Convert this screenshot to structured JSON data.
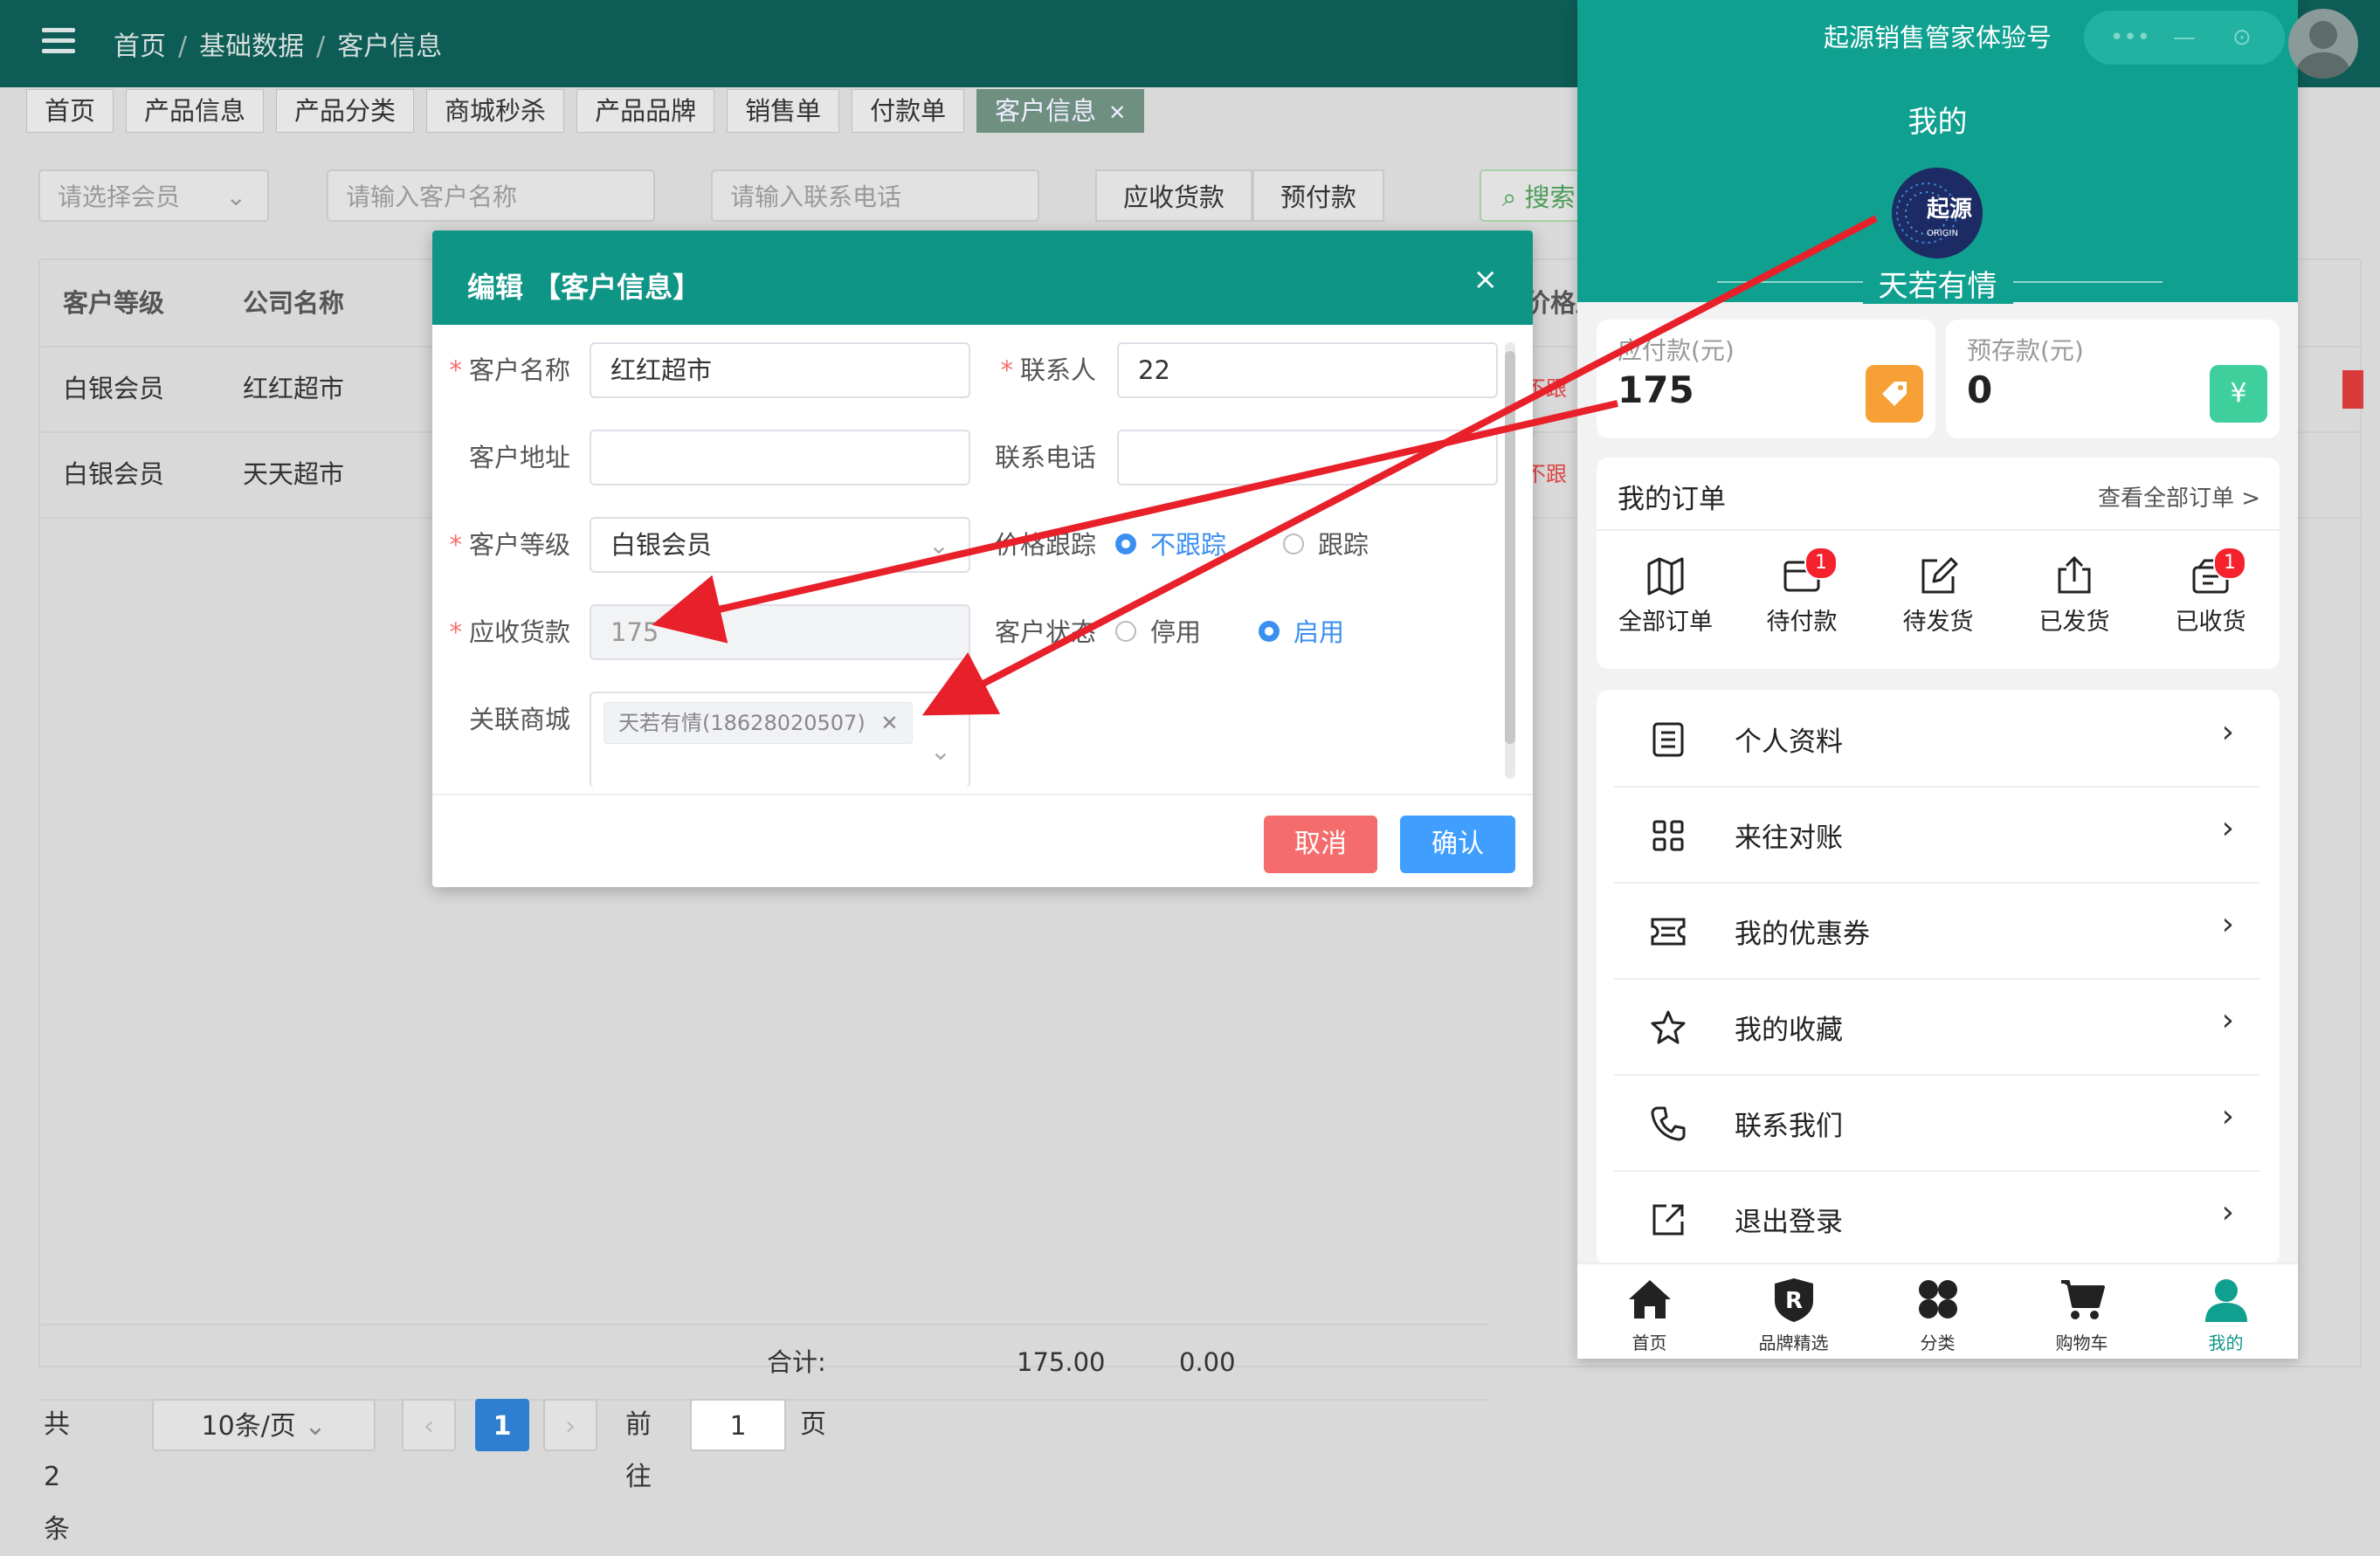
{
  "breadcrumb": [
    "首页",
    "基础数据",
    "客户信息"
  ],
  "tabs": [
    {
      "label": "首页"
    },
    {
      "label": "产品信息"
    },
    {
      "label": "产品分类"
    },
    {
      "label": "商城秒杀"
    },
    {
      "label": "产品品牌"
    },
    {
      "label": "销售单"
    },
    {
      "label": "付款单"
    },
    {
      "label": "客户信息"
    }
  ],
  "filters": {
    "member_placeholder": "请选择会员",
    "name_placeholder": "请输入客户名称",
    "phone_placeholder": "请输入联系电话",
    "btn_receivable": "应收货款",
    "btn_prepay": "预付款",
    "search": "搜索"
  },
  "table": {
    "headers": [
      "客户等级",
      "公司名称",
      "价格跟"
    ],
    "rows": [
      {
        "level": "白银会员",
        "company": "红红超市",
        "tag": "不跟"
      },
      {
        "level": "白银会员",
        "company": "天天超市",
        "tag": "不跟"
      }
    ],
    "total_label": "合计:",
    "total_receivable": "175.00",
    "total_prepay": "0.00"
  },
  "pager": {
    "total": "共 2 条",
    "page_size": "10条/页",
    "current": "1",
    "goto_label": "前往",
    "goto_value": "1",
    "page_suffix": "页",
    "prev": "‹",
    "next": "›"
  },
  "dialog": {
    "title": "编辑 【客户信息】",
    "close": "×",
    "name_label": "客户名称",
    "name_value": "红红超市",
    "contact_label": "联系人",
    "contact_value": "22",
    "address_label": "客户地址",
    "address_value": "",
    "phone_label": "联系电话",
    "phone_value": "",
    "level_label": "客户等级",
    "level_value": "白银会员",
    "price_track_label": "价格跟踪",
    "price_track_options": [
      "不跟踪",
      "跟踪"
    ],
    "price_track_selected": 0,
    "receivable_label": "应收货款",
    "receivable_value": "175",
    "status_label": "客户状态",
    "status_options": [
      "停用",
      "启用"
    ],
    "status_selected": 1,
    "mall_label": "关联商城",
    "mall_tag": "天若有情(18628020507)",
    "cancel": "取消",
    "confirm": "确认",
    "cancel_color": "#f56c6c",
    "confirm_color": "#409eff"
  },
  "phone": {
    "app_title": "起源销售管家体验号",
    "capsule_more": "•••",
    "capsule_min": "—",
    "capsule_close": "⊙",
    "page_title": "我的",
    "avatar_text": "起源",
    "avatar_sub": "ORIGIN",
    "username": "天若有情",
    "payable_label": "应付款(元)",
    "payable_value": "175",
    "deposit_label": "预存款(元)",
    "deposit_value": "0",
    "deposit_icon": "¥",
    "orders_title": "我的订单",
    "orders_all": "查看全部订单 >",
    "order_items": [
      {
        "label": "全部订单",
        "icon": "map-icon",
        "badge": ""
      },
      {
        "label": "待付款",
        "icon": "wallet-icon",
        "badge": "1"
      },
      {
        "label": "待发货",
        "icon": "edit-icon",
        "badge": ""
      },
      {
        "label": "已发货",
        "icon": "upload-icon",
        "badge": ""
      },
      {
        "label": "已收货",
        "icon": "box-icon",
        "badge": "1"
      }
    ],
    "menu": [
      {
        "label": "个人资料",
        "icon": "profile-icon"
      },
      {
        "label": "来往对账",
        "icon": "grid-icon"
      },
      {
        "label": "我的优惠券",
        "icon": "coupon-icon"
      },
      {
        "label": "我的收藏",
        "icon": "star-icon"
      },
      {
        "label": "联系我们",
        "icon": "phone-icon"
      },
      {
        "label": "退出登录",
        "icon": "logout-icon"
      }
    ],
    "menu_arrow": "›",
    "tabbar": [
      {
        "label": "首页",
        "icon": "home-icon"
      },
      {
        "label": "品牌精选",
        "icon": "brand-icon"
      },
      {
        "label": "分类",
        "icon": "category-icon"
      },
      {
        "label": "购物车",
        "icon": "cart-icon"
      },
      {
        "label": "我的",
        "icon": "user-icon"
      }
    ],
    "accent": "#10a090"
  },
  "annotation_color": "#e8202a"
}
